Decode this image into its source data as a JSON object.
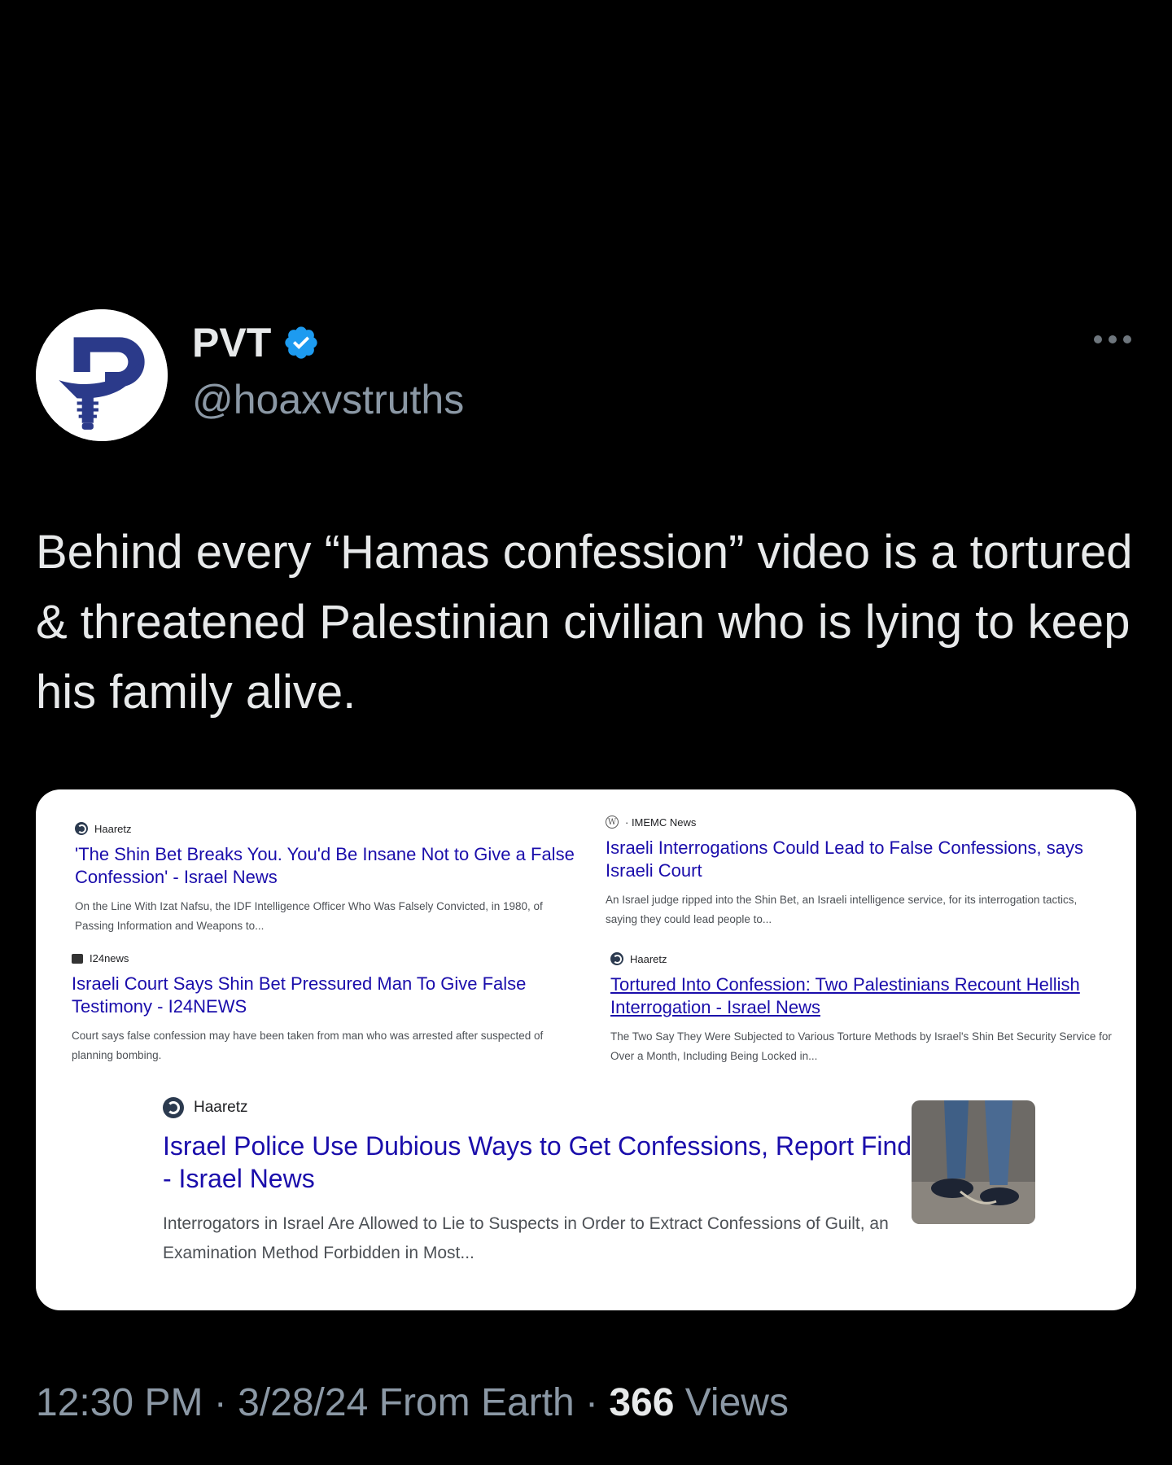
{
  "author": {
    "display_name": "PVT",
    "handle": "@hoaxvstruths",
    "verified": true,
    "avatar_icon": "pvt-logo-icon"
  },
  "tweet": {
    "text": "Behind every “Hamas confession” video is a tortured & threatened Palestinian civilian who is lying to keep his family alive."
  },
  "media": {
    "results": [
      {
        "source": "Haaretz",
        "title": "'The Shin Bet Breaks You. You'd Be Insane Not to Give a False Confession' - Israel News",
        "snippet": "On the Line With Izat Nafsu, the IDF Intelligence Officer Who Was Falsely Convicted, in 1980, of Passing Information and Weapons to..."
      },
      {
        "source": "· IMEMC News",
        "title": "Israeli Interrogations Could Lead to False Confessions, says Israeli Court",
        "snippet": "An Israel judge ripped into the Shin Bet, an Israeli intelligence service, for its interrogation tactics, saying they could lead people to..."
      },
      {
        "source": "I24news",
        "title": "Israeli Court Says Shin Bet Pressured Man To Give False Testimony - I24NEWS",
        "snippet": "Court says false confession may have been taken from man who was arrested after suspected of planning bombing."
      },
      {
        "source": "Haaretz",
        "title": "Tortured Into Confession: Two Palestinians Recount Hellish Interrogation - Israel News",
        "snippet": "The Two Say They Were Subjected to Various Torture Methods by Israel's Shin Bet Security Service for Over a Month, Including Being Locked in..."
      },
      {
        "source": "Haaretz",
        "title": "Israel Police Use Dubious Ways to Get Confessions, Report Finds - Israel News",
        "snippet": "Interrogators in Israel Are Allowed to Lie to Suspects in Order to Extract Confessions of Guilt, an Examination Method Forbidden in Most..."
      }
    ]
  },
  "footer": {
    "time": "12:30 PM",
    "date": "3/28/24",
    "location": "From Earth",
    "views_count": "366",
    "views_label": "Views"
  },
  "colors": {
    "background": "#000000",
    "text_primary": "#e7e9ea",
    "text_secondary": "#8b98a5",
    "verified_badge": "#1d9bf0",
    "logo_blue": "#2b3a8a",
    "link": "#1a0dab"
  }
}
